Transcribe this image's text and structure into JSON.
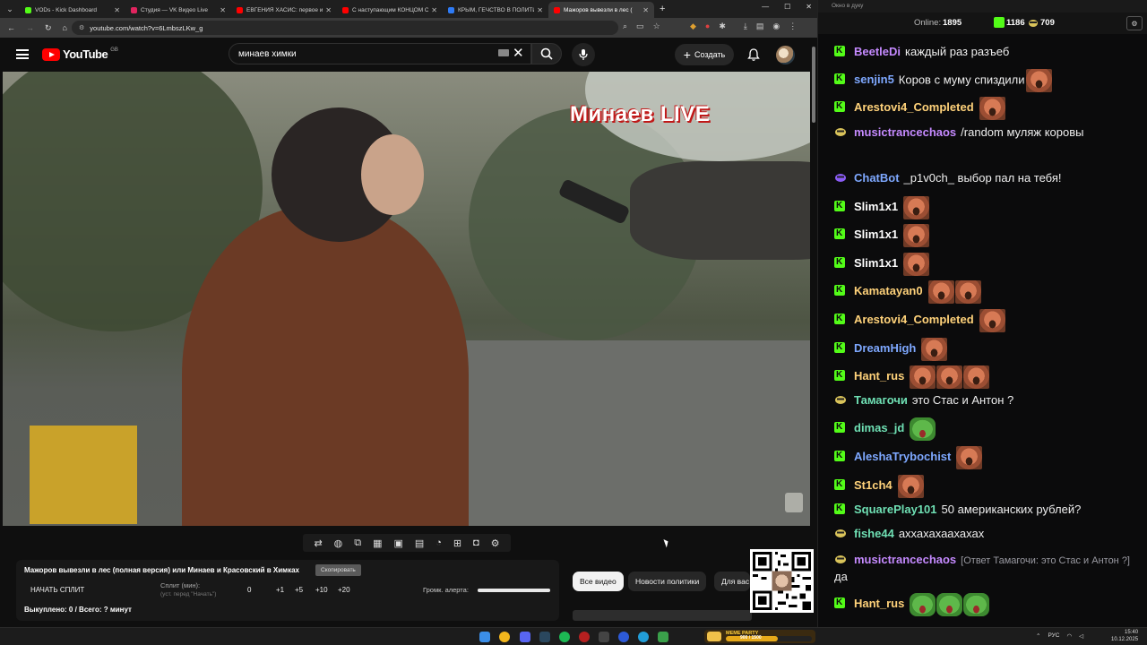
{
  "browser": {
    "tabs": [
      {
        "title": "VODs - Kick Dashboard",
        "favicon_color": "#53fc18",
        "active": false
      },
      {
        "title": "Студия — VK Видео Live",
        "favicon_color": "#e0245e",
        "active": false
      },
      {
        "title": "ЕВГЕНИЯ ХАСИС: первое инте",
        "favicon_color": "#ff0000",
        "active": false
      },
      {
        "title": "С наступающим КОНЦОМ СВ",
        "favicon_color": "#ff0000",
        "active": false
      },
      {
        "title": "КРЫМ, ГЕЧСТВО В ПОЛИТИКЕ",
        "favicon_color": "#2e7bf6",
        "active": false
      },
      {
        "title": "Мажоров вывезли в лес (",
        "favicon_color": "#ff0000",
        "active": true
      }
    ],
    "url": "youtube.com/watch?v=6LmbszLKw_g"
  },
  "youtube": {
    "logo_text": "YouTube",
    "region": "GB",
    "search_query": "минаев химки",
    "create_label": "Создать"
  },
  "video": {
    "watermark_main": "Минаев",
    "watermark_live": "LIVE"
  },
  "panel": {
    "title": "Мажоров вывезли в лес (полная версия) или Минаев и Красовский в Химках",
    "copy_label": "Скопировать",
    "start_split": "НАЧАТЬ СПЛИТ",
    "split_label": "Сплит (мин):",
    "split_hint": "(уст. перед \"Начать\")",
    "split_values": [
      "0",
      "+1",
      "+5",
      "+10",
      "+20"
    ],
    "alert_label": "Громк. алерта:",
    "alert_volume": 1.0,
    "bought": "Выкуплено: 0 / Всего: ? минут"
  },
  "chips": [
    "Все видео",
    "Новости политики",
    "Для вас"
  ],
  "chat": {
    "window_title": "Окно в дуку",
    "online_label": "Online:",
    "online_count": "1895",
    "kick_count": "1186",
    "other_count": "709",
    "messages": [
      {
        "user": "BeetleDi",
        "color": "#c58aff",
        "badge": "kick",
        "text": "каждый раз разъеб",
        "emotes": []
      },
      {
        "user": "senjin5",
        "color": "#7ea8ff",
        "badge": "kick",
        "text": "Коров с муму спиздили",
        "emotes": [
          "face"
        ]
      },
      {
        "user": "Arestovi4_Completed",
        "color": "#ffd27a",
        "badge": "kick",
        "text": "",
        "emotes": [
          "face"
        ]
      },
      {
        "user": "musictrancechaos",
        "color": "#c58aff",
        "badge": "bot",
        "text": "/random муляж коровы",
        "emotes": []
      },
      {
        "user": "ChatBot",
        "color": "#7ea8ff",
        "badge": "bot2",
        "text": "_p1v0ch_ выбор пал на тебя!",
        "emotes": []
      },
      {
        "user": "Slim1x1",
        "color": "#ffffff",
        "badge": "kick",
        "text": "",
        "emotes": [
          "face"
        ]
      },
      {
        "user": "Slim1x1",
        "color": "#ffffff",
        "badge": "kick",
        "text": "",
        "emotes": [
          "face"
        ]
      },
      {
        "user": "Slim1x1",
        "color": "#ffffff",
        "badge": "kick",
        "text": "",
        "emotes": [
          "face"
        ]
      },
      {
        "user": "Kamatayan0",
        "color": "#ffd27a",
        "badge": "kick",
        "text": "",
        "emotes": [
          "face",
          "face"
        ]
      },
      {
        "user": "Arestovi4_Completed",
        "color": "#ffd27a",
        "badge": "kick",
        "text": "",
        "emotes": [
          "face"
        ]
      },
      {
        "user": "DreamHigh",
        "color": "#7ea8ff",
        "badge": "kick",
        "text": "",
        "emotes": [
          "face"
        ]
      },
      {
        "user": "Hant_rus",
        "color": "#ffd27a",
        "badge": "kick",
        "text": "",
        "emotes": [
          "face",
          "face",
          "face"
        ]
      },
      {
        "user": "Тамагочи",
        "color": "#6fe0b4",
        "badge": "bot",
        "text": "это Стас и Антон ?",
        "emotes": []
      },
      {
        "user": "dimas_jd",
        "color": "#6fe0b4",
        "badge": "kick",
        "text": "",
        "emotes": [
          "pepe"
        ]
      },
      {
        "user": "AleshaTrybochist",
        "color": "#7ea8ff",
        "badge": "kick",
        "text": "",
        "emotes": [
          "face"
        ]
      },
      {
        "user": "St1ch4",
        "color": "#ffd27a",
        "badge": "kick",
        "text": "",
        "emotes": [
          "face"
        ]
      },
      {
        "user": "SquarePlay101",
        "color": "#6fe0b4",
        "badge": "kick",
        "text": "50 американских рублей?",
        "emotes": []
      },
      {
        "user": "fishe44",
        "color": "#6fe0b4",
        "badge": "bot",
        "text": "аххахахаахахах",
        "emotes": []
      },
      {
        "user": "musictrancechaos",
        "color": "#c58aff",
        "badge": "bot",
        "text": "да",
        "reply": "[Ответ Тамагочи: это Стас и Антон ?]",
        "emotes": []
      },
      {
        "user": "Hant_rus",
        "color": "#ffd27a",
        "badge": "kick",
        "text": "",
        "emotes": [
          "pepe",
          "pepe",
          "pepe"
        ]
      }
    ]
  },
  "taskbar": {
    "meme_title": "MEME PARTY",
    "meme_count": "900 / 1500",
    "meme_fraction": 0.6,
    "lang": "РУС",
    "time": "15:40",
    "date": "10.12.2025"
  }
}
